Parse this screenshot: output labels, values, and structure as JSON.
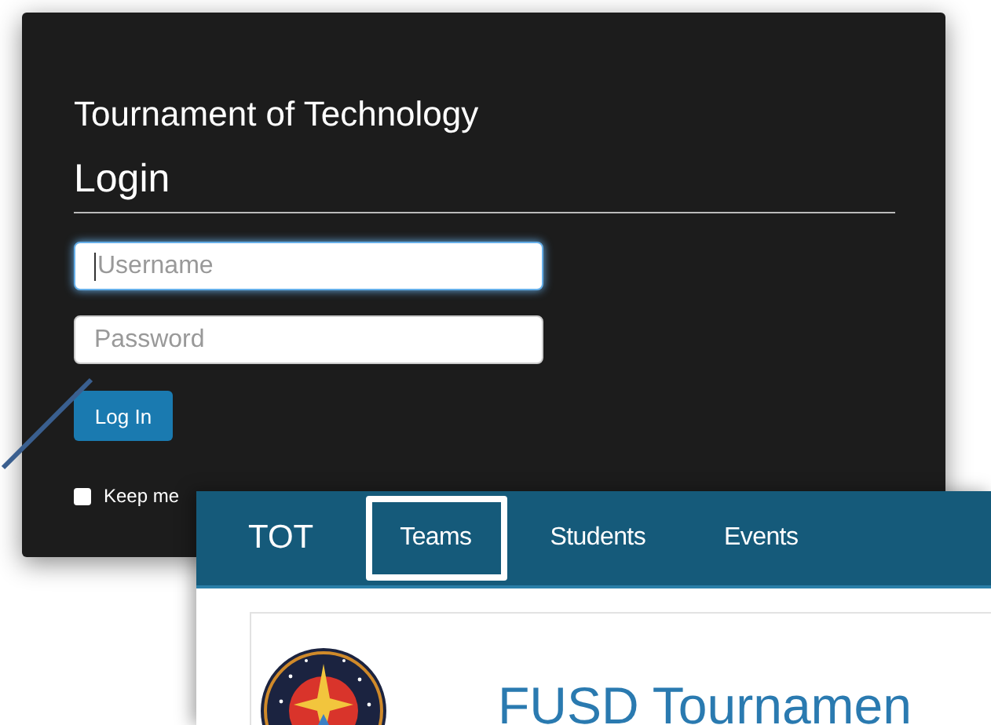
{
  "login_panel": {
    "site_title": "Tournament of Technology",
    "heading": "Login",
    "fields": [
      {
        "placeholder": "Username",
        "focused": true
      },
      {
        "placeholder": "Password",
        "focused": false
      }
    ],
    "button": "Log In",
    "remember": {
      "label": "Keep me",
      "checked": false
    }
  },
  "nav_panel": {
    "brand": "TOT",
    "nav_items": [
      {
        "label": "Teams",
        "selected": true
      },
      {
        "label": "Students",
        "selected": false
      },
      {
        "label": "Events",
        "selected": false
      }
    ],
    "page_heading": "FUSD Tournamen"
  }
}
